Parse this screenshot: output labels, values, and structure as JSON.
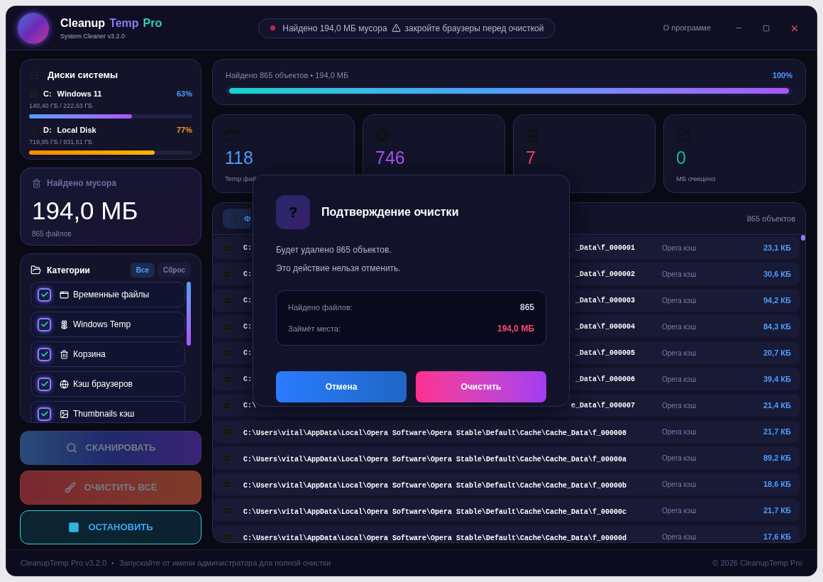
{
  "app": {
    "name_parts": [
      "Cleanup",
      "Temp",
      "Pro"
    ],
    "subtitle": "System Cleaner v3.2.0"
  },
  "status_pill": {
    "text_before": "Найдено 194,0 МБ мусора",
    "text_after": "закройте браузеры перед очисткой"
  },
  "about_link": "О программе",
  "disks": {
    "title": "Диски системы",
    "items": [
      {
        "kind": "system",
        "letter": "C:",
        "label": "Windows 11",
        "percent": "63%",
        "usage": "140,40 ГБ / 222,63 ГБ",
        "level": 0.63,
        "color": "#4f9dff"
      },
      {
        "kind": "local",
        "letter": "D:",
        "label": "Local Disk",
        "percent": "77%",
        "usage": "719,95 ГБ / 931,51 ГБ",
        "level": 0.77,
        "color": "#ff9a1a"
      }
    ]
  },
  "junk": {
    "title": "Найдено мусора",
    "size": "194,0 МБ",
    "files": "865 файлов"
  },
  "categories": {
    "title": "Категории",
    "all_button": "Все",
    "reset_button": "Сброс",
    "items": [
      {
        "kind": "temp",
        "label": "Временные файлы",
        "checked": true
      },
      {
        "kind": "windows",
        "label": "Windows Temp",
        "checked": true
      },
      {
        "kind": "trash",
        "label": "Корзина",
        "checked": true
      },
      {
        "kind": "browser",
        "label": "Кэш браузеров",
        "checked": true
      },
      {
        "kind": "thumbs",
        "label": "Thumbnails кэш",
        "checked": true
      }
    ]
  },
  "actions": [
    {
      "kind": "scan",
      "label": "СКАНИРОВАТЬ",
      "disabled": true
    },
    {
      "kind": "clean",
      "label": "ОЧИСТИТЬ ВСЁ",
      "disabled": true
    },
    {
      "kind": "stop",
      "label": "ОСТАНОВИТЬ",
      "disabled": false
    }
  ],
  "progress": {
    "text": "Найдено 865 объектов • 194,0 МБ",
    "percent": "100%",
    "level": 1
  },
  "stats": [
    {
      "kind": "temp",
      "value": "118",
      "label": "Temp фай",
      "color": "#4f9dff"
    },
    {
      "kind": "browser",
      "value": "746",
      "color": "#a855f7"
    },
    {
      "kind": "trash",
      "value": "7",
      "color": "#f43f5e"
    },
    {
      "kind": "cleaned",
      "value": "0",
      "label": "МБ очищено",
      "color": "#14b8a6"
    }
  ],
  "files": {
    "tab": {
      "label": "Ф",
      "selected": true
    },
    "count": "865 объектов",
    "rows": [
      {
        "path_start": "C:",
        "path_end": "_Data\\f_000001",
        "category": "Opera кэш",
        "size": "23,1 КБ"
      },
      {
        "path_start": "C:",
        "path_end": "_Data\\f_000002",
        "category": "Opera кэш",
        "size": "30,6 КБ"
      },
      {
        "path_start": "C:",
        "path_end": "_Data\\f_000003",
        "category": "Opera кэш",
        "size": "94,2 КБ"
      },
      {
        "path_start": "C:",
        "path_end": "_Data\\f_000004",
        "category": "Opera кэш",
        "size": "84,3 КБ"
      },
      {
        "path_start": "C:",
        "path_end": "_Data\\f_000005",
        "category": "Opera кэш",
        "size": "20,7 КБ"
      },
      {
        "path_start": "C:",
        "path_end": "_Data\\f_000006",
        "category": "Opera кэш",
        "size": "39,4 КБ"
      },
      {
        "path_start": "C:\\",
        "path_end": "e_Data\\f_000007",
        "category": "Opera кэш",
        "size": "21,4 КБ"
      },
      {
        "path": "C:\\Users\\vital\\AppData\\Local\\Opera Software\\Opera Stable\\Default\\Cache\\Cache_Data\\f_000008",
        "category": "Opera кэш",
        "size": "21,7 КБ"
      },
      {
        "path": "C:\\Users\\vital\\AppData\\Local\\Opera Software\\Opera Stable\\Default\\Cache\\Cache_Data\\f_00000a",
        "category": "Opera кэш",
        "size": "89,2 КБ"
      },
      {
        "path": "C:\\Users\\vital\\AppData\\Local\\Opera Software\\Opera Stable\\Default\\Cache\\Cache_Data\\f_00000b",
        "category": "Opera кэш",
        "size": "18,6 КБ"
      },
      {
        "path": "C:\\Users\\vital\\AppData\\Local\\Opera Software\\Opera Stable\\Default\\Cache\\Cache_Data\\f_00000c",
        "category": "Opera кэш",
        "size": "21,7 КБ"
      },
      {
        "path": "C:\\Users\\vital\\AppData\\Local\\Opera Software\\Opera Stable\\Default\\Cache\\Cache_Data\\f_00000d",
        "category": "Opera кэш",
        "size": "17,6 КБ"
      }
    ]
  },
  "dialog": {
    "icon": "?",
    "title": "Подтверждение очистки",
    "lines": [
      "Будет удалено 865 объектов.",
      "Это действие нельзя отменить."
    ],
    "summary": [
      {
        "kind": "count",
        "label": "Найдено файлов:",
        "value": "865"
      },
      {
        "kind": "size",
        "label": "Займёт места:",
        "value": "194,0 МБ"
      }
    ],
    "cancel": "Отмена",
    "confirm": "Очистить"
  },
  "footer": {
    "left": "CleanupTemp Pro v3.2.0",
    "separator": "•",
    "hint": "Запускайте от имени администратора для полной очистки",
    "right": "© 2026 CleanupTemp Pro"
  }
}
